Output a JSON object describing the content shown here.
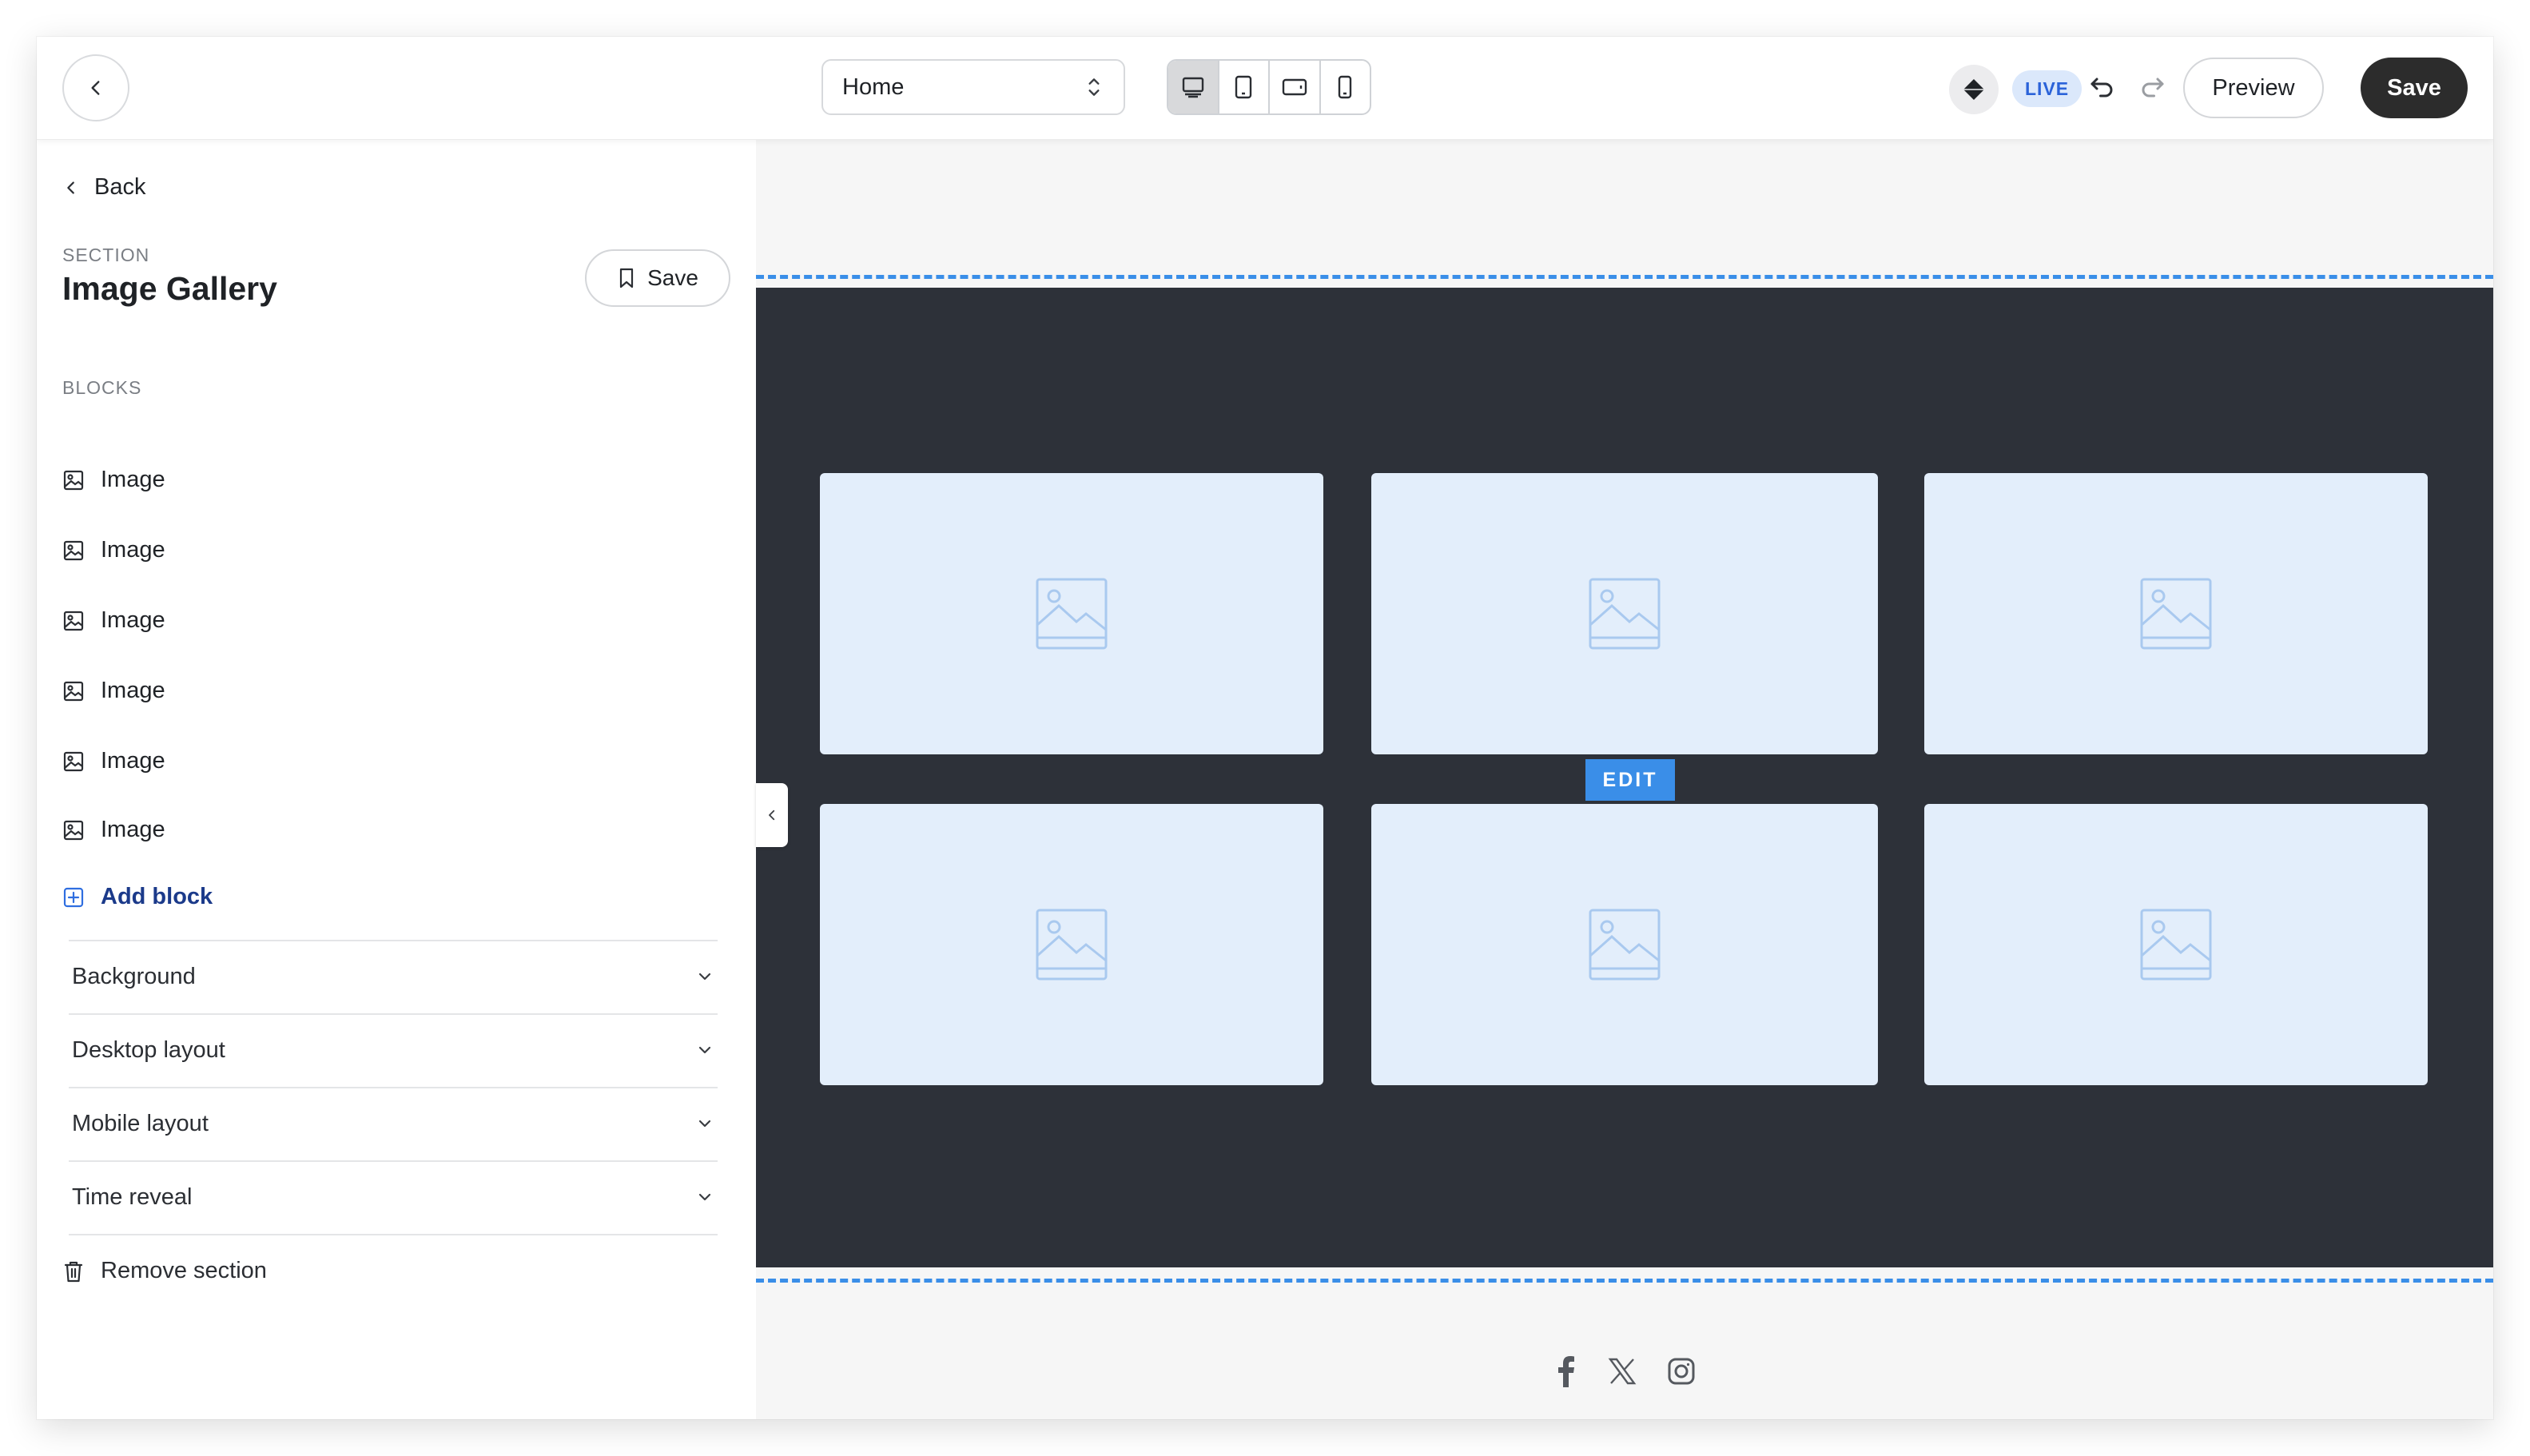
{
  "topbar": {
    "page_selector": {
      "value": "Home"
    },
    "devices": [
      "desktop-icon",
      "tablet-portrait-icon",
      "tablet-landscape-icon",
      "mobile-icon"
    ],
    "active_device": "desktop-icon",
    "live_badge": "LIVE",
    "preview_label": "Preview",
    "save_label": "Save"
  },
  "sidebar": {
    "back_label": "Back",
    "section_label": "SECTION",
    "section_title": "Image Gallery",
    "save_label": "Save",
    "blocks_label": "BLOCKS",
    "blocks": [
      {
        "label": "Image",
        "icon": "image-icon"
      },
      {
        "label": "Image",
        "icon": "image-icon"
      },
      {
        "label": "Image",
        "icon": "image-icon"
      },
      {
        "label": "Image",
        "icon": "image-icon"
      },
      {
        "label": "Image",
        "icon": "image-icon"
      },
      {
        "label": "Image",
        "icon": "image-icon"
      }
    ],
    "add_block_label": "Add block",
    "accordions": [
      "Background",
      "Desktop layout",
      "Mobile layout",
      "Time reveal"
    ],
    "remove_section_label": "Remove section"
  },
  "canvas": {
    "edit_label": "EDIT",
    "gallery_tiles": 6,
    "social_icons": [
      "facebook-icon",
      "x-twitter-icon",
      "instagram-icon"
    ]
  },
  "colors": {
    "accent": "#3a8ee8",
    "gallery_bg": "#2d3139",
    "tile_bg": "#e3eefb",
    "save_bg": "#2c2c2c",
    "live_bg": "#dbe8fb",
    "add_block": "#1b3a8a"
  }
}
